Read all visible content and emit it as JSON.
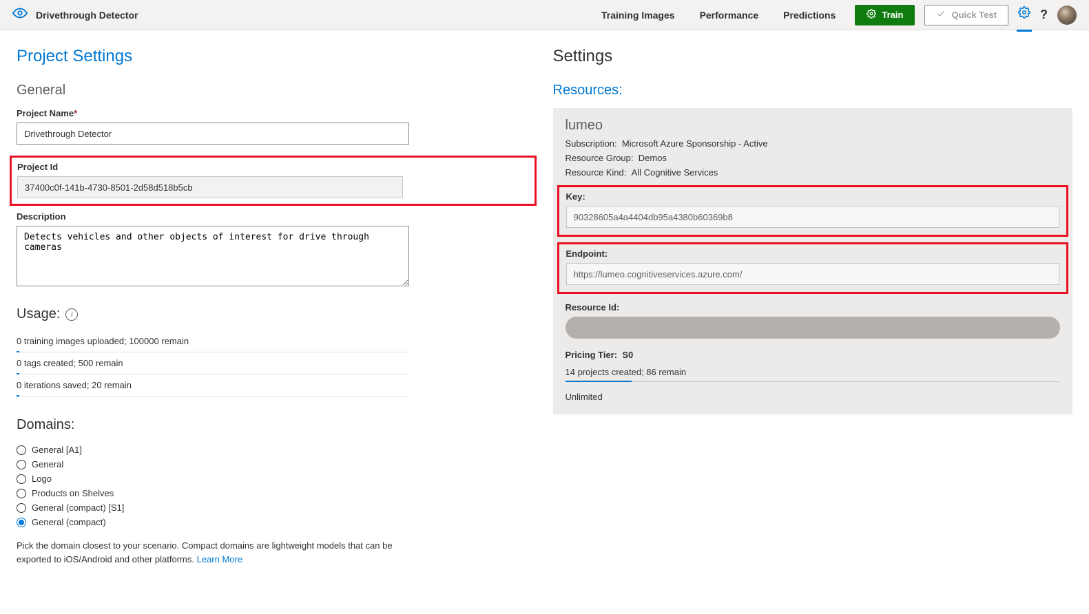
{
  "header": {
    "app_title": "Drivethrough Detector",
    "nav": {
      "training_images": "Training Images",
      "performance": "Performance",
      "predictions": "Predictions"
    },
    "train_label": "Train",
    "quick_test_label": "Quick Test"
  },
  "left": {
    "title": "Project Settings",
    "general": {
      "heading": "General",
      "project_name_label": "Project Name",
      "project_name_value": "Drivethrough Detector",
      "project_id_label": "Project Id",
      "project_id_value": "37400c0f-141b-4730-8501-2d58d518b5cb",
      "description_label": "Description",
      "description_value": "Detects vehicles and other objects of interest for drive through cameras"
    },
    "usage": {
      "heading": "Usage:",
      "row1": "0 training images uploaded; 100000 remain",
      "row2": "0 tags created; 500 remain",
      "row3": "0 iterations saved; 20 remain"
    },
    "domains": {
      "heading": "Domains:",
      "options": [
        "General [A1]",
        "General",
        "Logo",
        "Products on Shelves",
        "General (compact) [S1]",
        "General (compact)"
      ],
      "selected_index": 5,
      "note": "Pick the domain closest to your scenario. Compact domains are lightweight models that can be exported to iOS/Android and other platforms.",
      "learn_more": "Learn More"
    }
  },
  "right": {
    "title": "Settings",
    "resources_heading": "Resources:",
    "resource": {
      "name": "lumeo",
      "subscription_label": "Subscription:",
      "subscription_value": "Microsoft Azure Sponsorship - Active",
      "resource_group_label": "Resource Group:",
      "resource_group_value": "Demos",
      "resource_kind_label": "Resource Kind:",
      "resource_kind_value": "All Cognitive Services",
      "key_label": "Key:",
      "key_value": "90328605a4a4404db95a4380b60369b8",
      "endpoint_label": "Endpoint:",
      "endpoint_value": "https://lumeo.cognitiveservices.azure.com/",
      "resource_id_label": "Resource Id:",
      "pricing_tier_label": "Pricing Tier:",
      "pricing_tier_value": "S0",
      "projects_row": "14 projects created; 86 remain",
      "unlimited": "Unlimited"
    }
  }
}
